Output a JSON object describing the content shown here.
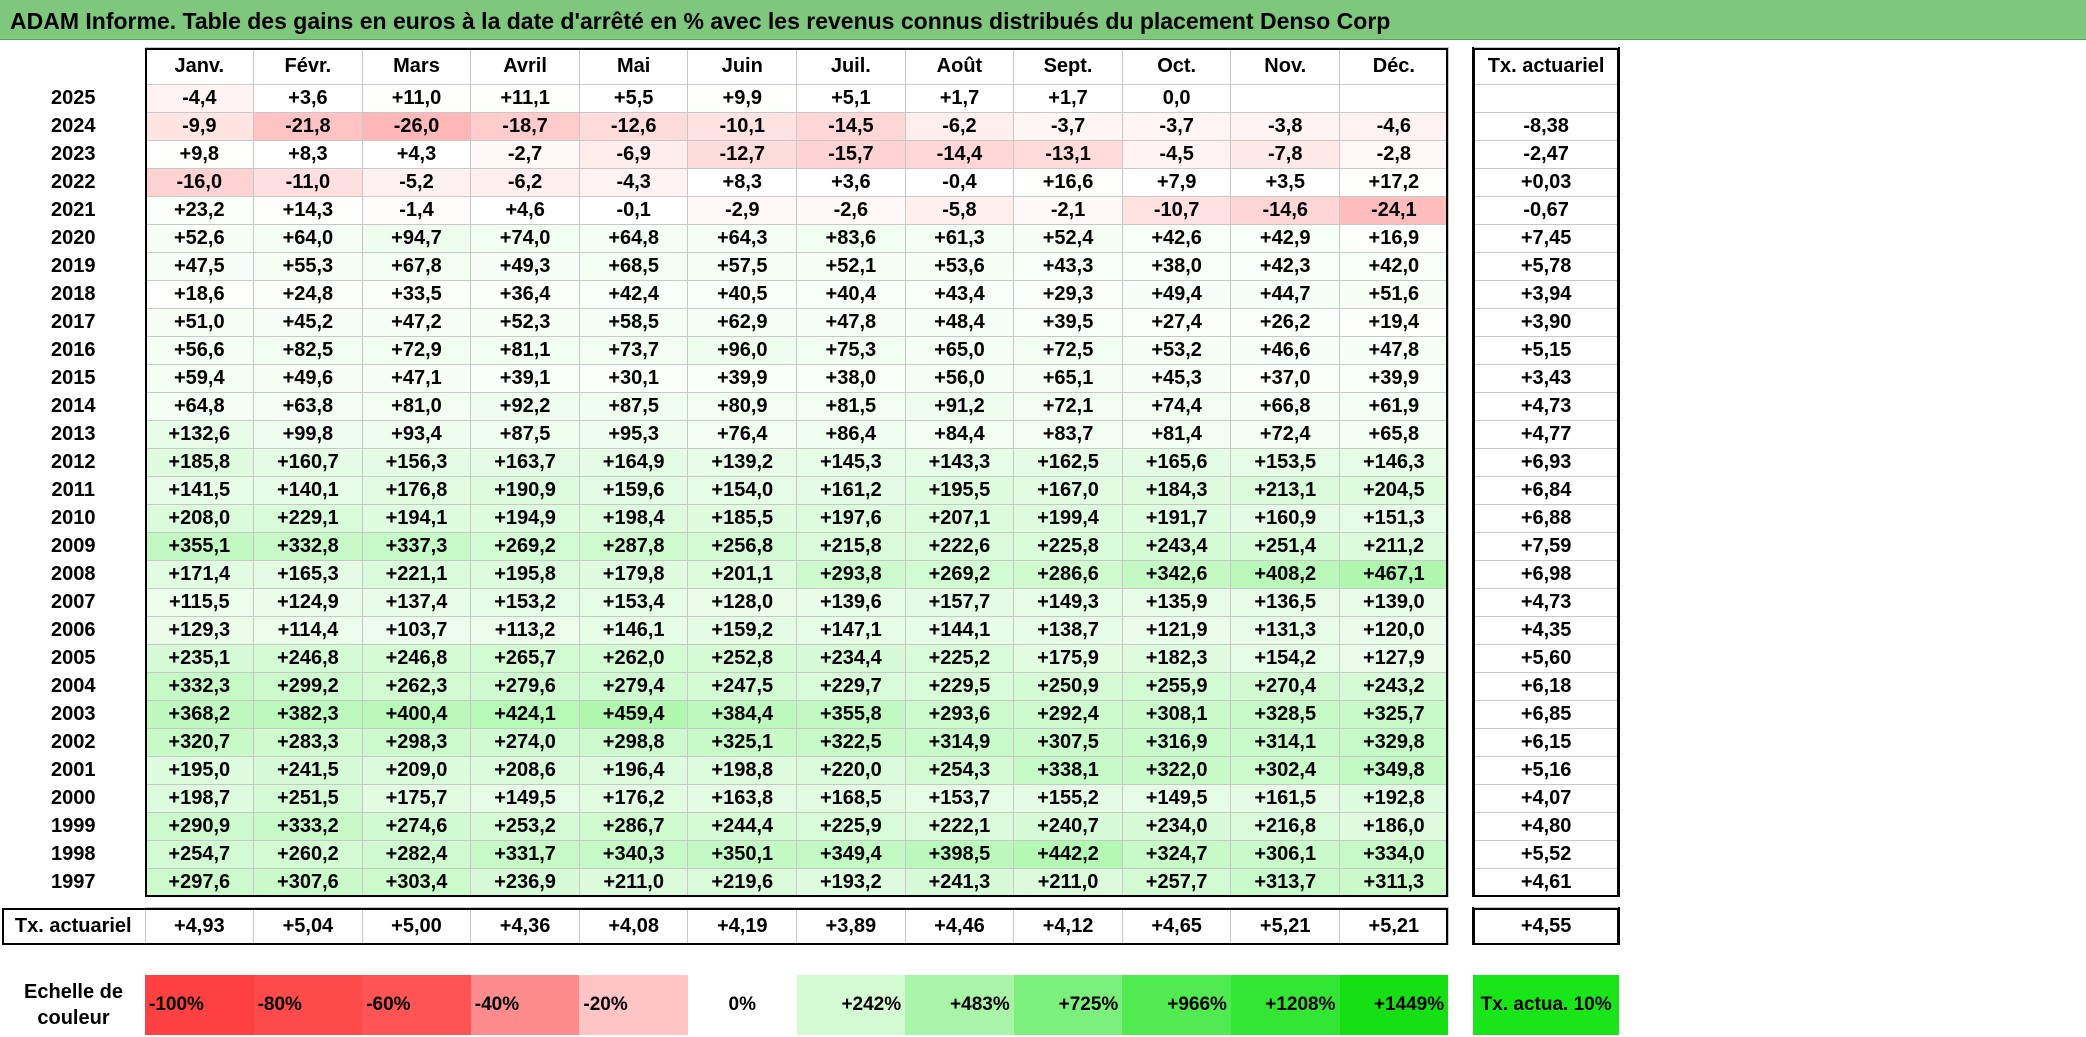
{
  "title": "ADAM Informe. Table des gains en euros à la date d'arrêté en % avec les revenus connus distribués du placement Denso Corp",
  "months": [
    "Janv.",
    "Févr.",
    "Mars",
    "Avril",
    "Mai",
    "Juin",
    "Juil.",
    "Août",
    "Sept.",
    "Oct.",
    "Nov.",
    "Déc."
  ],
  "rate_header": "Tx. actuariel",
  "rows": [
    {
      "year": "2025",
      "values": [
        "-4,4",
        "+3,6",
        "+11,0",
        "+11,1",
        "+5,5",
        "+9,9",
        "+5,1",
        "+1,7",
        "+1,7",
        "0,0",
        "",
        ""
      ],
      "rate": ""
    },
    {
      "year": "2024",
      "values": [
        "-9,9",
        "-21,8",
        "-26,0",
        "-18,7",
        "-12,6",
        "-10,1",
        "-14,5",
        "-6,2",
        "-3,7",
        "-3,7",
        "-3,8",
        "-4,6"
      ],
      "rate": "-8,38"
    },
    {
      "year": "2023",
      "values": [
        "+9,8",
        "+8,3",
        "+4,3",
        "-2,7",
        "-6,9",
        "-12,7",
        "-15,7",
        "-14,4",
        "-13,1",
        "-4,5",
        "-7,8",
        "-2,8"
      ],
      "rate": "-2,47"
    },
    {
      "year": "2022",
      "values": [
        "-16,0",
        "-11,0",
        "-5,2",
        "-6,2",
        "-4,3",
        "+8,3",
        "+3,6",
        "-0,4",
        "+16,6",
        "+7,9",
        "+3,5",
        "+17,2"
      ],
      "rate": "+0,03"
    },
    {
      "year": "2021",
      "values": [
        "+23,2",
        "+14,3",
        "-1,4",
        "+4,6",
        "-0,1",
        "-2,9",
        "-2,6",
        "-5,8",
        "-2,1",
        "-10,7",
        "-14,6",
        "-24,1"
      ],
      "rate": "-0,67"
    },
    {
      "year": "2020",
      "values": [
        "+52,6",
        "+64,0",
        "+94,7",
        "+74,0",
        "+64,8",
        "+64,3",
        "+83,6",
        "+61,3",
        "+52,4",
        "+42,6",
        "+42,9",
        "+16,9"
      ],
      "rate": "+7,45"
    },
    {
      "year": "2019",
      "values": [
        "+47,5",
        "+55,3",
        "+67,8",
        "+49,3",
        "+68,5",
        "+57,5",
        "+52,1",
        "+53,6",
        "+43,3",
        "+38,0",
        "+42,3",
        "+42,0"
      ],
      "rate": "+5,78"
    },
    {
      "year": "2018",
      "values": [
        "+18,6",
        "+24,8",
        "+33,5",
        "+36,4",
        "+42,4",
        "+40,5",
        "+40,4",
        "+43,4",
        "+29,3",
        "+49,4",
        "+44,7",
        "+51,6"
      ],
      "rate": "+3,94"
    },
    {
      "year": "2017",
      "values": [
        "+51,0",
        "+45,2",
        "+47,2",
        "+52,3",
        "+58,5",
        "+62,9",
        "+47,8",
        "+48,4",
        "+39,5",
        "+27,4",
        "+26,2",
        "+19,4"
      ],
      "rate": "+3,90"
    },
    {
      "year": "2016",
      "values": [
        "+56,6",
        "+82,5",
        "+72,9",
        "+81,1",
        "+73,7",
        "+96,0",
        "+75,3",
        "+65,0",
        "+72,5",
        "+53,2",
        "+46,6",
        "+47,8"
      ],
      "rate": "+5,15"
    },
    {
      "year": "2015",
      "values": [
        "+59,4",
        "+49,6",
        "+47,1",
        "+39,1",
        "+30,1",
        "+39,9",
        "+38,0",
        "+56,0",
        "+65,1",
        "+45,3",
        "+37,0",
        "+39,9"
      ],
      "rate": "+3,43"
    },
    {
      "year": "2014",
      "values": [
        "+64,8",
        "+63,8",
        "+81,0",
        "+92,2",
        "+87,5",
        "+80,9",
        "+81,5",
        "+91,2",
        "+72,1",
        "+74,4",
        "+66,8",
        "+61,9"
      ],
      "rate": "+4,73"
    },
    {
      "year": "2013",
      "values": [
        "+132,6",
        "+99,8",
        "+93,4",
        "+87,5",
        "+95,3",
        "+76,4",
        "+86,4",
        "+84,4",
        "+83,7",
        "+81,4",
        "+72,4",
        "+65,8"
      ],
      "rate": "+4,77"
    },
    {
      "year": "2012",
      "values": [
        "+185,8",
        "+160,7",
        "+156,3",
        "+163,7",
        "+164,9",
        "+139,2",
        "+145,3",
        "+143,3",
        "+162,5",
        "+165,6",
        "+153,5",
        "+146,3"
      ],
      "rate": "+6,93"
    },
    {
      "year": "2011",
      "values": [
        "+141,5",
        "+140,1",
        "+176,8",
        "+190,9",
        "+159,6",
        "+154,0",
        "+161,2",
        "+195,5",
        "+167,0",
        "+184,3",
        "+213,1",
        "+204,5"
      ],
      "rate": "+6,84"
    },
    {
      "year": "2010",
      "values": [
        "+208,0",
        "+229,1",
        "+194,1",
        "+194,9",
        "+198,4",
        "+185,5",
        "+197,6",
        "+207,1",
        "+199,4",
        "+191,7",
        "+160,9",
        "+151,3"
      ],
      "rate": "+6,88"
    },
    {
      "year": "2009",
      "values": [
        "+355,1",
        "+332,8",
        "+337,3",
        "+269,2",
        "+287,8",
        "+256,8",
        "+215,8",
        "+222,6",
        "+225,8",
        "+243,4",
        "+251,4",
        "+211,2"
      ],
      "rate": "+7,59"
    },
    {
      "year": "2008",
      "values": [
        "+171,4",
        "+165,3",
        "+221,1",
        "+195,8",
        "+179,8",
        "+201,1",
        "+293,8",
        "+269,2",
        "+286,6",
        "+342,6",
        "+408,2",
        "+467,1"
      ],
      "rate": "+6,98"
    },
    {
      "year": "2007",
      "values": [
        "+115,5",
        "+124,9",
        "+137,4",
        "+153,2",
        "+153,4",
        "+128,0",
        "+139,6",
        "+157,7",
        "+149,3",
        "+135,9",
        "+136,5",
        "+139,0"
      ],
      "rate": "+4,73"
    },
    {
      "year": "2006",
      "values": [
        "+129,3",
        "+114,4",
        "+103,7",
        "+113,2",
        "+146,1",
        "+159,2",
        "+147,1",
        "+144,1",
        "+138,7",
        "+121,9",
        "+131,3",
        "+120,0"
      ],
      "rate": "+4,35"
    },
    {
      "year": "2005",
      "values": [
        "+235,1",
        "+246,8",
        "+246,8",
        "+265,7",
        "+262,0",
        "+252,8",
        "+234,4",
        "+225,2",
        "+175,9",
        "+182,3",
        "+154,2",
        "+127,9"
      ],
      "rate": "+5,60"
    },
    {
      "year": "2004",
      "values": [
        "+332,3",
        "+299,2",
        "+262,3",
        "+279,6",
        "+279,4",
        "+247,5",
        "+229,7",
        "+229,5",
        "+250,9",
        "+255,9",
        "+270,4",
        "+243,2"
      ],
      "rate": "+6,18"
    },
    {
      "year": "2003",
      "values": [
        "+368,2",
        "+382,3",
        "+400,4",
        "+424,1",
        "+459,4",
        "+384,4",
        "+355,8",
        "+293,6",
        "+292,4",
        "+308,1",
        "+328,5",
        "+325,7"
      ],
      "rate": "+6,85"
    },
    {
      "year": "2002",
      "values": [
        "+320,7",
        "+283,3",
        "+298,3",
        "+274,0",
        "+298,8",
        "+325,1",
        "+322,5",
        "+314,9",
        "+307,5",
        "+316,9",
        "+314,1",
        "+329,8"
      ],
      "rate": "+6,15"
    },
    {
      "year": "2001",
      "values": [
        "+195,0",
        "+241,5",
        "+209,0",
        "+208,6",
        "+196,4",
        "+198,8",
        "+220,0",
        "+254,3",
        "+338,1",
        "+322,0",
        "+302,4",
        "+349,8"
      ],
      "rate": "+5,16"
    },
    {
      "year": "2000",
      "values": [
        "+198,7",
        "+251,5",
        "+175,7",
        "+149,5",
        "+176,2",
        "+163,8",
        "+168,5",
        "+153,7",
        "+155,2",
        "+149,5",
        "+161,5",
        "+192,8"
      ],
      "rate": "+4,07"
    },
    {
      "year": "1999",
      "values": [
        "+290,9",
        "+333,2",
        "+274,6",
        "+253,2",
        "+286,7",
        "+244,4",
        "+225,9",
        "+222,1",
        "+240,7",
        "+234,0",
        "+216,8",
        "+186,0"
      ],
      "rate": "+4,80"
    },
    {
      "year": "1998",
      "values": [
        "+254,7",
        "+260,2",
        "+282,4",
        "+331,7",
        "+340,3",
        "+350,1",
        "+349,4",
        "+398,5",
        "+442,2",
        "+324,7",
        "+306,1",
        "+334,0"
      ],
      "rate": "+5,52"
    },
    {
      "year": "1997",
      "values": [
        "+297,6",
        "+307,6",
        "+303,4",
        "+236,9",
        "+211,0",
        "+219,6",
        "+193,2",
        "+241,3",
        "+211,0",
        "+257,7",
        "+313,7",
        "+311,3"
      ],
      "rate": "+4,61"
    }
  ],
  "footer": {
    "label": "Tx. actuariel",
    "values": [
      "+4,93",
      "+5,04",
      "+5,00",
      "+4,36",
      "+4,08",
      "+4,19",
      "+3,89",
      "+4,46",
      "+4,12",
      "+4,65",
      "+5,21",
      "+5,21"
    ],
    "rate": "+4,55"
  },
  "scale": {
    "label": "Echelle de couleur",
    "steps": [
      {
        "label": "-100%",
        "color": "#ff4040"
      },
      {
        "label": "-80%",
        "color": "#ff4a4a"
      },
      {
        "label": "-60%",
        "color": "#ff5454"
      },
      {
        "label": "-40%",
        "color": "#ff8c8c"
      },
      {
        "label": "-20%",
        "color": "#ffc4c4"
      },
      {
        "label": "0%",
        "color": "#ffffff"
      },
      {
        "label": "+242%",
        "color": "#d4fad4"
      },
      {
        "label": "+483%",
        "color": "#a8f5a8"
      },
      {
        "label": "+725%",
        "color": "#7cf07c"
      },
      {
        "label": "+966%",
        "color": "#50eb50"
      },
      {
        "label": "+1208%",
        "color": "#33e633"
      },
      {
        "label": "+1449%",
        "color": "#14e014"
      }
    ],
    "rate_label": "Tx. actua. 10%",
    "rate_color": "#19e619"
  }
}
